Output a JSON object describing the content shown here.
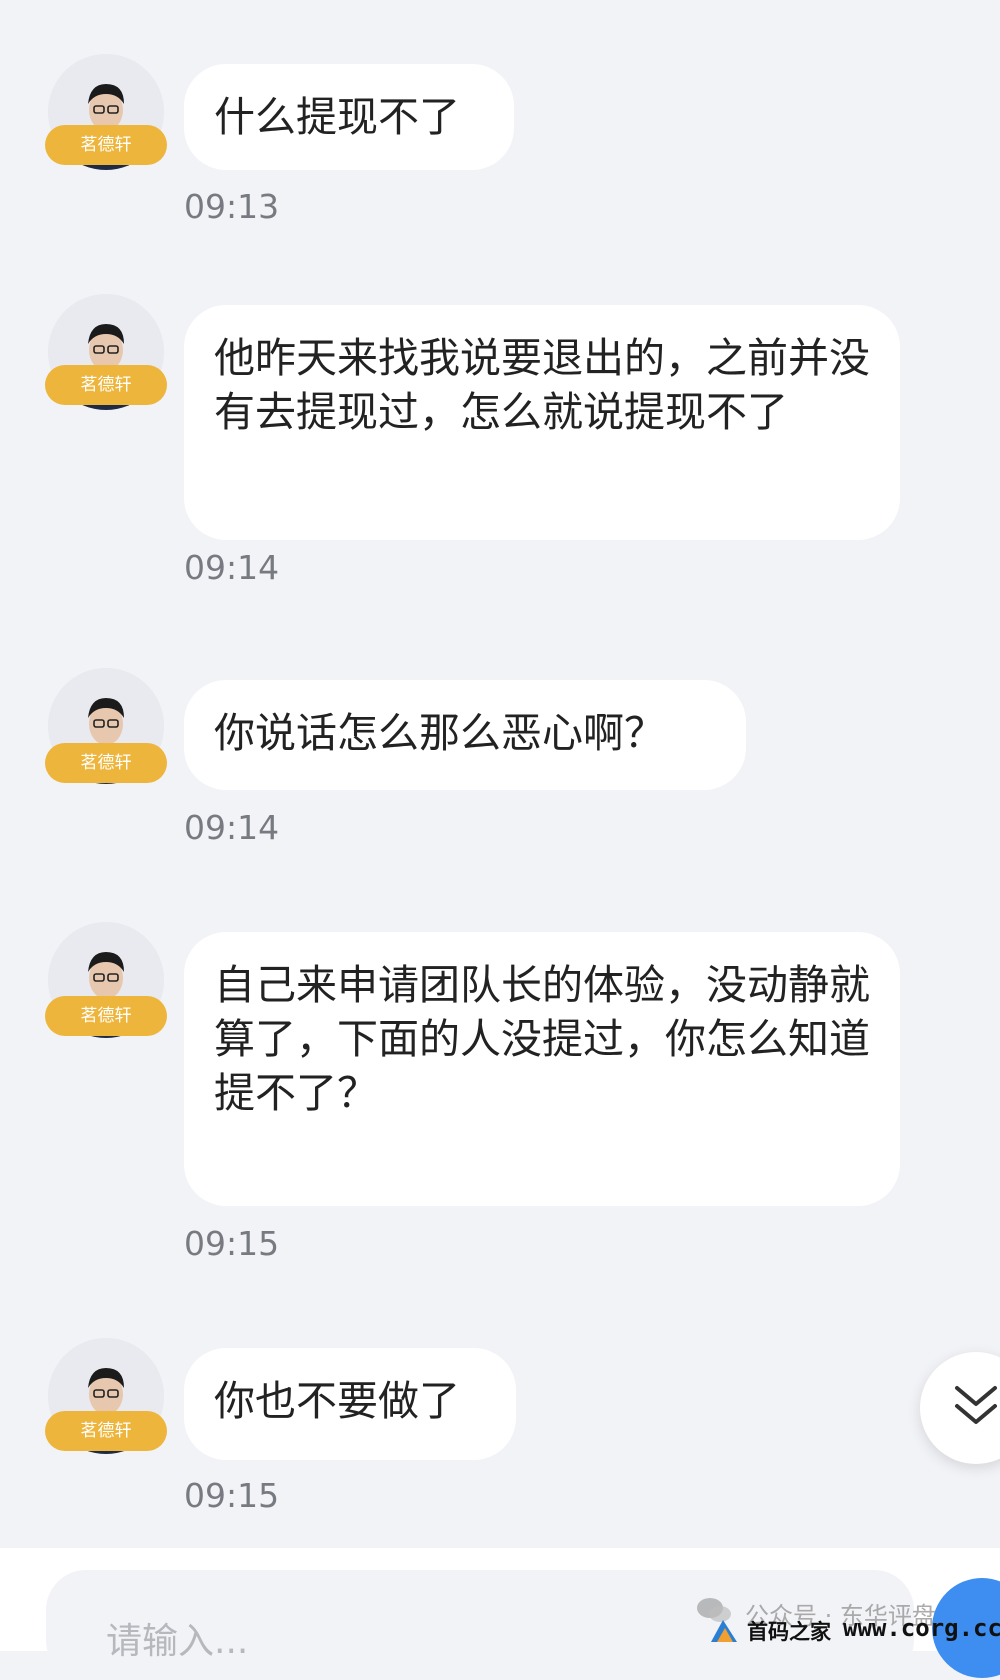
{
  "messages": [
    {
      "sender": "茗德轩",
      "text": "什么提现不了",
      "time": "09:13"
    },
    {
      "sender": "茗德轩",
      "text": "他昨天来找我说要退出的，之前并没有去提现过，怎么就说提现不了",
      "time": "09:14"
    },
    {
      "sender": "茗德轩",
      "text": "你说话怎么那么恶心啊？",
      "time": "09:14"
    },
    {
      "sender": "茗德轩",
      "text": "自己来申请团队长的体验，没动静就算了，下面的人没提过，你怎么知道提不了？",
      "time": "09:15"
    },
    {
      "sender": "茗德轩",
      "text": "你也不要做了",
      "time": "09:15"
    }
  ],
  "input": {
    "placeholder": "请输入..."
  },
  "watermark": {
    "line1": "公众号 · 东华评盘",
    "line2": "首码之家",
    "url": "www.corg.cc"
  },
  "icons": {
    "scroll_down": "double-chevron-down-icon",
    "avatar": "avatar-icon",
    "send": "send-icon"
  },
  "colors": {
    "background": "#f2f3f7",
    "bubble": "#ffffff",
    "badge": "#eeb53c",
    "time": "#777a80",
    "send": "#3d8ef0"
  }
}
